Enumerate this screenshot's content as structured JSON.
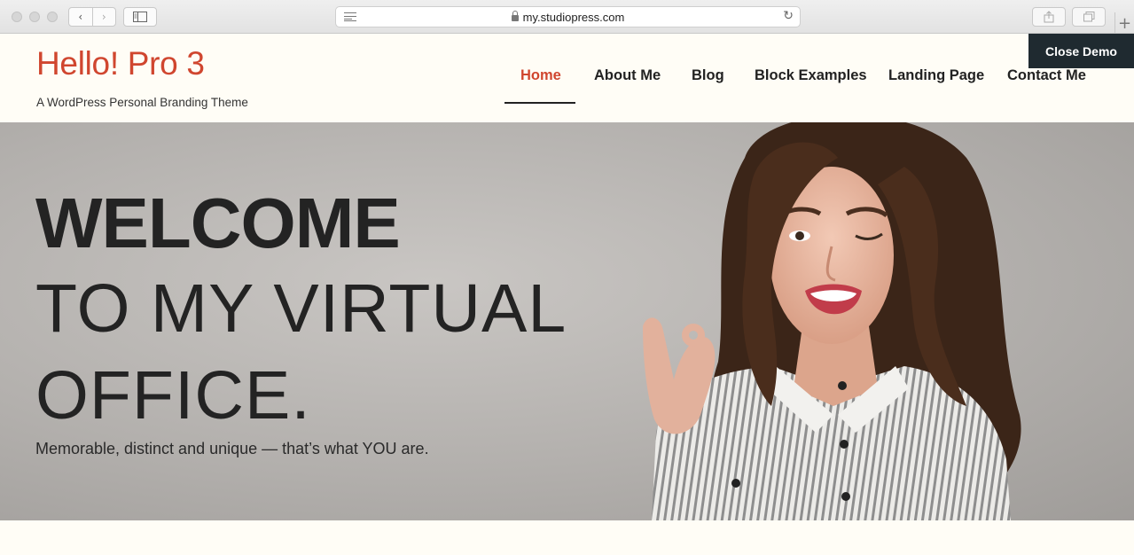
{
  "browser": {
    "url": "my.studiopress.com",
    "back_glyph": "‹",
    "forward_glyph": "›",
    "reload_glyph": "↻",
    "new_tab_glyph": "+"
  },
  "site": {
    "title": "Hello! Pro 3",
    "description": "A WordPress Personal Branding Theme",
    "accent_color": "#d0462f",
    "nav": [
      {
        "label": "Home",
        "active": true
      },
      {
        "label": "About Me"
      },
      {
        "label": "Blog"
      },
      {
        "label": "Block Examples"
      },
      {
        "label": "Landing Page"
      },
      {
        "label": "Contact Me"
      }
    ],
    "close_demo_label": "Close Demo"
  },
  "hero": {
    "line1": "WELCOME",
    "line2": "TO MY VIRTUAL",
    "line3": "OFFICE.",
    "subtitle": "Memorable, distinct and unique — that’s what YOU are."
  }
}
